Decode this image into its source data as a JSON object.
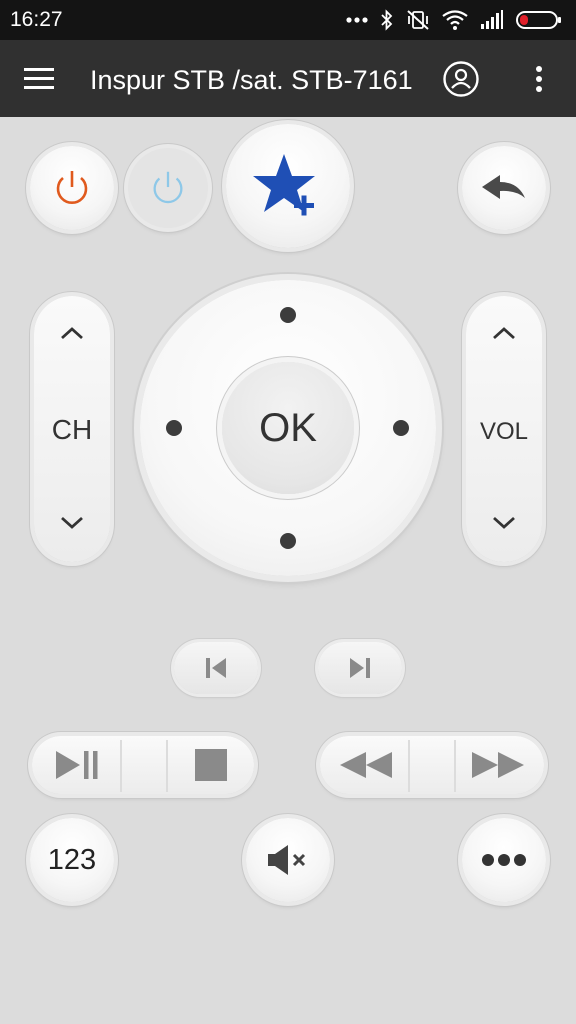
{
  "status_bar": {
    "time": "16:27",
    "icons": [
      "more-dots-icon",
      "bluetooth-icon",
      "vibrate-off-icon",
      "wifi-icon",
      "signal-icon",
      "battery-low-icon"
    ],
    "battery_color": "#e0202a"
  },
  "app_bar": {
    "title": "Inspur STB /sat. STB-7161",
    "icons": [
      "menu-icon",
      "account-icon",
      "overflow-menu-icon"
    ]
  },
  "remote": {
    "power_colors": {
      "primary": "#e05a1e",
      "secondary": "#8ec8e8"
    },
    "favorite_color": "#1f4fb5",
    "channel_label": "CH",
    "volume_label": "VOL",
    "ok_label": "OK",
    "numpad_label": "123",
    "buttons": [
      "power-button",
      "secondary-power-button",
      "add-favorite-button",
      "back-button",
      "channel-up-button",
      "channel-down-button",
      "dpad-up",
      "dpad-left",
      "ok-button",
      "dpad-right",
      "dpad-down",
      "volume-up-button",
      "volume-down-button",
      "skip-previous-button",
      "skip-next-button",
      "play-pause-button",
      "stop-button",
      "rewind-button",
      "fast-forward-button",
      "numpad-button",
      "mute-button",
      "more-button"
    ]
  }
}
